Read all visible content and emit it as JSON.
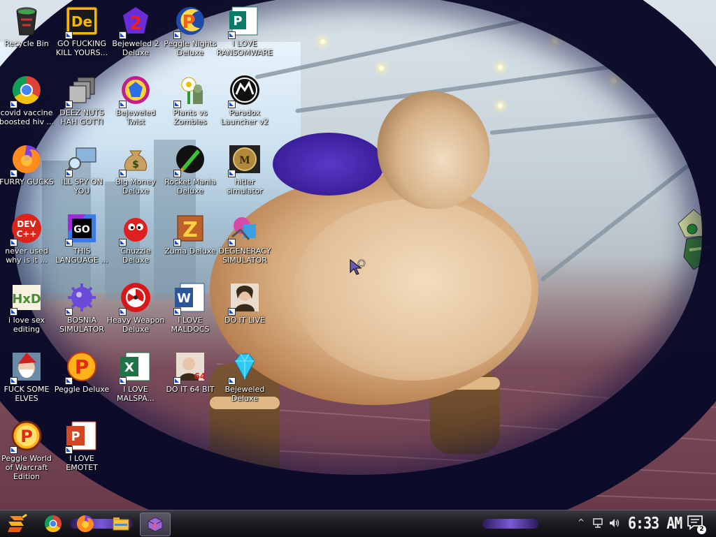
{
  "desktop": {
    "icons": [
      {
        "label": "Recycle Bin",
        "icon": "recycle-bin-icon"
      },
      {
        "label": "GO FUCKING KILL YOURS...",
        "icon": "de-icon"
      },
      {
        "label": "Bejeweled 2 Deluxe",
        "icon": "bejeweled-2-icon"
      },
      {
        "label": "Peggle Nights Deluxe",
        "icon": "peggle-nights-icon"
      },
      {
        "label": "I LOVE RANSOMWARE",
        "icon": "publisher-icon"
      },
      {
        "label": "covid vaccine boosted hiv ...",
        "icon": "chrome-icon"
      },
      {
        "label": "DEEZ NUTS HAH GOTTI",
        "icon": "window-stack-icon"
      },
      {
        "label": "Bejeweled Twist",
        "icon": "bejeweled-twist-icon"
      },
      {
        "label": "Plants vs Zombies",
        "icon": "plants-vs-zombies-icon"
      },
      {
        "label": "Paradox Launcher v2",
        "icon": "paradox-icon"
      },
      {
        "label": "FURRY GUCKS",
        "icon": "firefox-icon"
      },
      {
        "label": "ILL SPY ON YOU",
        "icon": "spy-monitor-icon"
      },
      {
        "label": "Big Money Deluxe",
        "icon": "money-bag-icon"
      },
      {
        "label": "Rocket Mania Deluxe",
        "icon": "rocket-mania-icon"
      },
      {
        "label": "hitler simulator",
        "icon": "hoi-icon"
      },
      {
        "label": "never used why is it ...",
        "icon": "dev-cpp-icon"
      },
      {
        "label": "THIS LANGUAGE ...",
        "icon": "goland-icon"
      },
      {
        "label": "Chuzzle Deluxe",
        "icon": "chuzzle-icon"
      },
      {
        "label": "Zuma Deluxe",
        "icon": "zuma-icon"
      },
      {
        "label": "DEGENERACY SIMULATOR",
        "icon": "ck-icon"
      },
      {
        "label": "i love sex editing",
        "icon": "hxd-icon"
      },
      {
        "label": "BOSNIA SIMULATOR",
        "icon": "mine-icon"
      },
      {
        "label": "Heavy Weapon Deluxe",
        "icon": "heavy-weapon-icon"
      },
      {
        "label": "I LOVE MALDOCS",
        "icon": "word-icon"
      },
      {
        "label": "DO IT LIVE",
        "icon": "portrait-icon"
      },
      {
        "label": "FUCK SOME ELVES",
        "icon": "santa-icon"
      },
      {
        "label": "Peggle Deluxe",
        "icon": "peggle-icon"
      },
      {
        "label": "I LOVE MALSPA...",
        "icon": "excel-icon"
      },
      {
        "label": "DO IT 64 BIT",
        "icon": "portrait-64-icon"
      },
      {
        "label": "Bejeweled Deluxe",
        "icon": "diamond-icon"
      },
      {
        "label": "Peggle World of Warcraft Edition",
        "icon": "peggle-wow-icon"
      },
      {
        "label": "I LOVE EMOTET",
        "icon": "powerpoint-icon"
      }
    ]
  },
  "taskbar": {
    "start": "start-icon",
    "pinned": [
      "chrome-icon",
      "firefox-icon",
      "file-explorer-icon",
      "winrar-icon"
    ],
    "tray": {
      "overflow_symbol": "^",
      "icons": [
        "network-icon",
        "volume-icon"
      ],
      "clock": "6:33 AM",
      "notification_count": "2"
    }
  },
  "colors": {
    "label_text": "#ffffff",
    "taskbar": "#1d1c22",
    "accent_purple": "#7a58d8"
  }
}
